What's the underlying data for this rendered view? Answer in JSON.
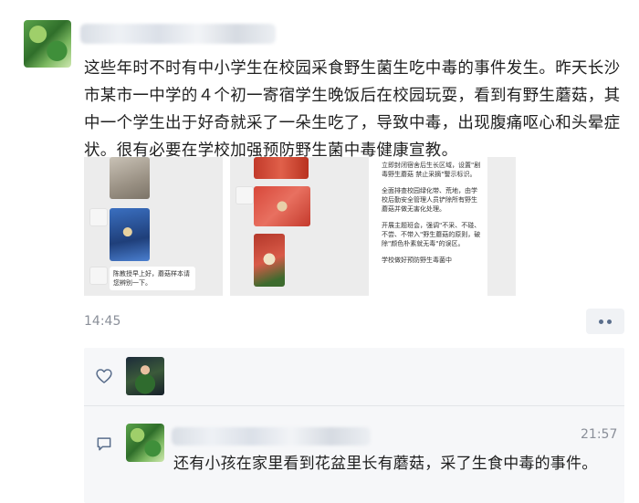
{
  "post": {
    "text": "这些年时不时有中小学生在校园采食野生菌生吃中毒的事件发生。昨天长沙市某市一中学的４个初一寄宿学生晚饭后在校园玩耍，看到有野生蘑菇，其中一个学生出于好奇就采了一朵生吃了，导致中毒，出现腹痛呕心和头晕症状。很有必要在学校加强预防野生菌中毒健康宣教。",
    "time": "14:45",
    "images": [
      {
        "caption": "陈教授早上好，蘑菇样本请您辨别一下。"
      },
      {
        "caption": ""
      },
      {
        "paragraphs": [
          "立即封闭宿舍后生长区域，设置\"剧毒野生蘑菇 禁止采摘\"警示标识。",
          "全面排查校园绿化带、荒地，由学校后勤安全管理人员铲除所有野生蘑菇并做无害化处理。",
          "开展主题班会，强调\"不采、不碰、不尝、不带入\"野生蘑菇的原则，破除\"颜色朴素就无毒\"的误区。",
          "学校做好预防野生毒菌中"
        ]
      }
    ]
  },
  "actions": {
    "more_icon": "more-dots-icon",
    "like_icon": "heart-icon",
    "comment_icon": "comment-icon"
  },
  "comment": {
    "time": "21:57",
    "text": "还有小孩在家里看到花盆里长有蘑菇，采了生食中毒的事件。"
  },
  "colors": {
    "accent": "#5a6e8c",
    "panel": "#f6f7f9",
    "muted_text": "#8a8f99"
  }
}
